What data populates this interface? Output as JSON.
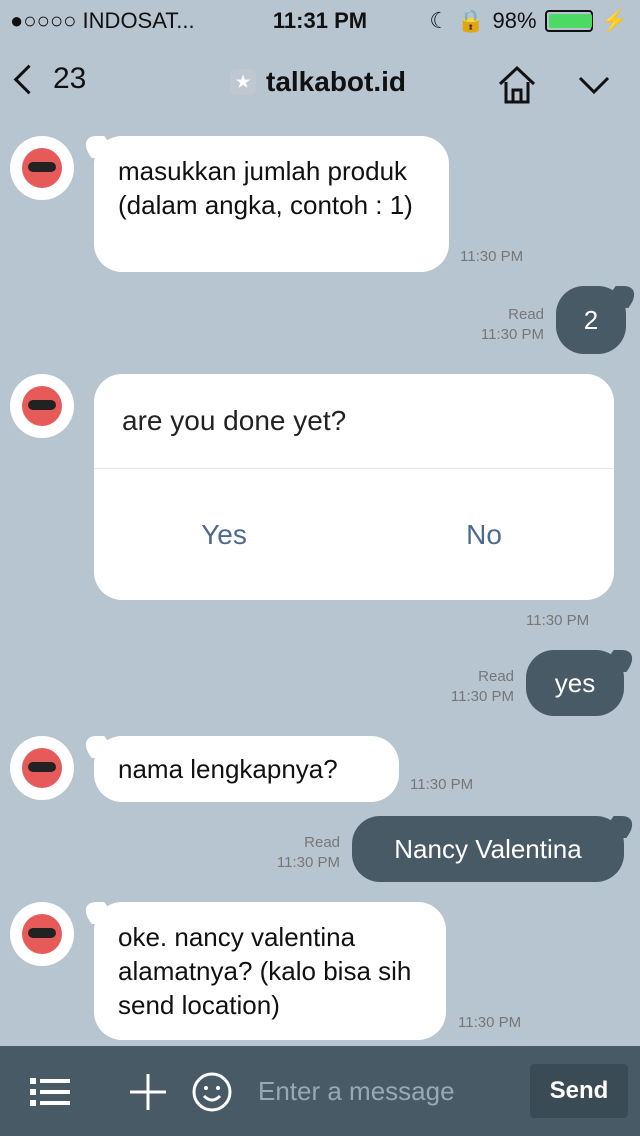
{
  "statusbar": {
    "carrier": "●○○○○ INDOSAT...",
    "time": "11:31 PM",
    "battery": "98%",
    "battery_level": 0.98
  },
  "navbar": {
    "back_count": "23",
    "title": "talkabot.id"
  },
  "messages": [
    {
      "side": "left",
      "text": "masukkan jumlah produk (dalam angka, contoh : 1)",
      "time": "11:30 PM"
    },
    {
      "side": "right",
      "text": "2",
      "status": "Read",
      "time": "11:30 PM"
    },
    {
      "side": "left",
      "text": "are you done yet?",
      "time": "11:30 PM",
      "choices": [
        "Yes",
        "No"
      ]
    },
    {
      "side": "right",
      "text": "yes",
      "status": "Read",
      "time": "11:30 PM"
    },
    {
      "side": "left",
      "text": "nama lengkapnya?",
      "time": "11:30 PM"
    },
    {
      "side": "right",
      "text": "Nancy Valentina",
      "status": "Read",
      "time": "11:30 PM"
    },
    {
      "side": "left",
      "text": "oke. nancy valentina alamatnya? (kalo bisa sih send location)",
      "time": "11:30 PM"
    }
  ],
  "composer": {
    "placeholder": "Enter a message",
    "send_label": "Send"
  },
  "colors": {
    "background": "#b7c5d1",
    "outgoing_bubble": "#485a66",
    "incoming_bubble": "#ffffff",
    "accent_blue": "#4d6a8e"
  },
  "icons": [
    "back-icon",
    "shield-star-icon",
    "home-icon",
    "chevron-down-icon",
    "robot-avatar-icon",
    "menu-icon",
    "plus-icon",
    "smile-icon"
  ]
}
